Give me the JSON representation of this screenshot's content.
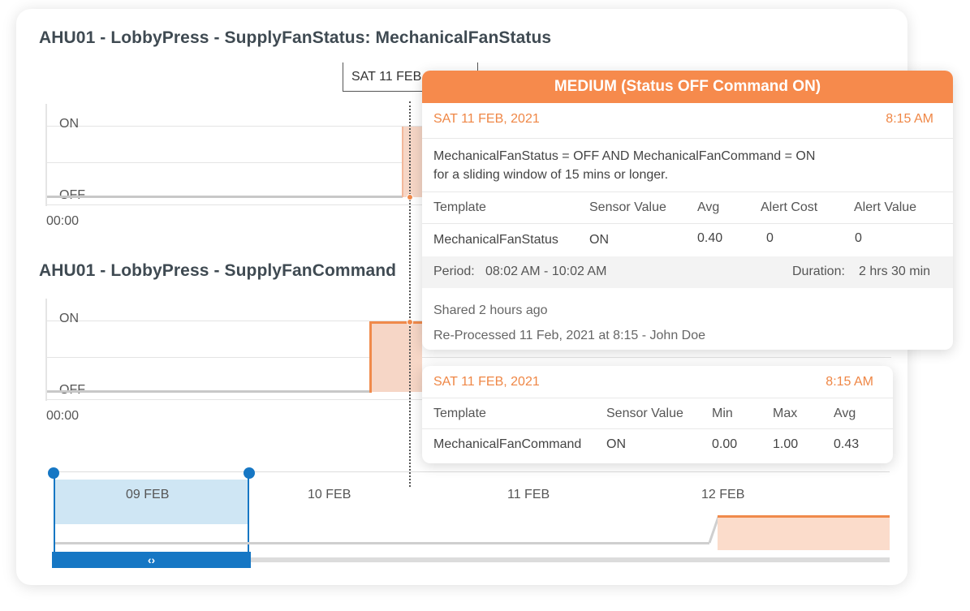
{
  "chart1": {
    "title": "AHU01 - LobbyPress - SupplyFanStatus: MechanicalFanStatus",
    "y_on": "ON",
    "y_off": "OFF",
    "x_start": "00:00"
  },
  "chart2": {
    "title": "AHU01 - LobbyPress - SupplyFanCommand",
    "y_on": "ON",
    "y_off": "OFF",
    "x_start": "00:00"
  },
  "cursor_date": "SAT 11 FEB",
  "navigator": {
    "dates": [
      "09 FEB",
      "10 FEB",
      "11 FEB",
      "12 FEB"
    ],
    "handle_icon": "‹›"
  },
  "alert": {
    "severity_title": "MEDIUM (Status OFF Command ON)",
    "date": "SAT 11 FEB, 2021",
    "time": "8:15 AM",
    "description_line1": "MechanicalFanStatus = OFF AND MechanicalFanCommand = ON",
    "description_line2": "for a sliding window of 15 mins or longer.",
    "columns": [
      "Template",
      "Sensor Value",
      "Avg",
      "Alert Cost",
      "Alert Value"
    ],
    "row": [
      "MechanicalFanStatus",
      "ON",
      "0.40",
      "0",
      "0"
    ],
    "period_label": "Period:",
    "period_value": "08:02 AM - 10:02 AM",
    "duration_label": "Duration:",
    "duration_value": "2 hrs 30 min",
    "shared": "Shared 2 hours ago",
    "reprocessed": "Re-Processed 11 Feb, 2021 at 8:15 - John Doe"
  },
  "command_tip": {
    "date": "SAT 11 FEB, 2021",
    "time": "8:15 AM",
    "columns": [
      "Template",
      "Sensor Value",
      "Min",
      "Max",
      "Avg"
    ],
    "row": [
      "MechanicalFanCommand",
      "ON",
      "0.00",
      "1.00",
      "0.43"
    ]
  },
  "colors": {
    "accent_orange": "#f68a4c",
    "selection_blue": "#1677c4"
  }
}
